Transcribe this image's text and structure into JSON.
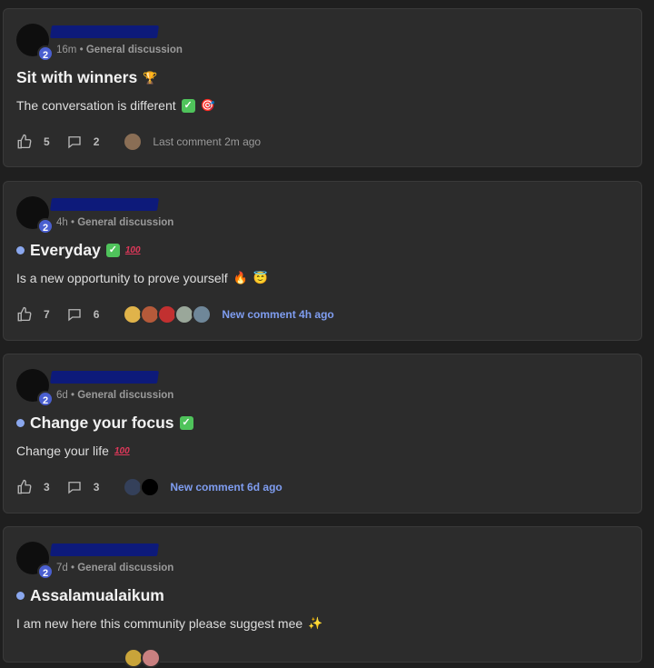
{
  "posts": [
    {
      "level": "2",
      "time": "16m",
      "sep": "•",
      "category": "General discussion",
      "title": "Sit with winners",
      "title_emojis": [
        "🏆"
      ],
      "unread": false,
      "body": "The conversation is different",
      "body_emojis": [
        "✅",
        "🎯"
      ],
      "likes": "5",
      "comments": "2",
      "comment_status": "Last comment 2m ago",
      "comment_status_type": "last",
      "commenter_colors": [
        "#8a6e55"
      ]
    },
    {
      "level": "2",
      "time": "4h",
      "sep": "•",
      "category": "General discussion",
      "title": "Everyday",
      "title_emojis": [
        "✅",
        "💯"
      ],
      "unread": true,
      "body": "Is a new opportunity to prove yourself",
      "body_emojis": [
        "🔥",
        "😇"
      ],
      "likes": "7",
      "comments": "6",
      "comment_status": "New comment 4h ago",
      "comment_status_type": "new",
      "commenter_colors": [
        "#e0b34a",
        "#b55a3a",
        "#c23030",
        "#9aa79a",
        "#6f8799"
      ]
    },
    {
      "level": "2",
      "time": "6d",
      "sep": "•",
      "category": "General discussion",
      "title": "Change your focus",
      "title_emojis": [
        "✅"
      ],
      "unread": true,
      "body": "Change your life",
      "body_emojis": [
        "💯"
      ],
      "likes": "3",
      "comments": "3",
      "comment_status": "New comment 6d ago",
      "comment_status_type": "new",
      "commenter_colors": [
        "#34405a",
        "#000000"
      ]
    },
    {
      "level": "2",
      "time": "7d",
      "sep": "•",
      "category": "General discussion",
      "title": "Assalamualaikum",
      "title_emojis": [],
      "unread": true,
      "body": "I am new here this community please suggest mee",
      "body_emojis": [
        "✨"
      ],
      "likes": "",
      "comments": "",
      "comment_status": "",
      "comment_status_type": "",
      "commenter_colors": [
        "#c9a43a",
        "#c98080"
      ]
    }
  ],
  "colors": {
    "background": "#1f1f1f",
    "card": "#2c2c2c",
    "level_badge": "#4a5fd0",
    "unread_dot": "#8aa7ee",
    "new_comment": "#7f9df0",
    "redaction": "#0d1a7a"
  },
  "icons": {
    "like": "thumbs-up-icon",
    "comment": "comment-bubble-icon"
  }
}
